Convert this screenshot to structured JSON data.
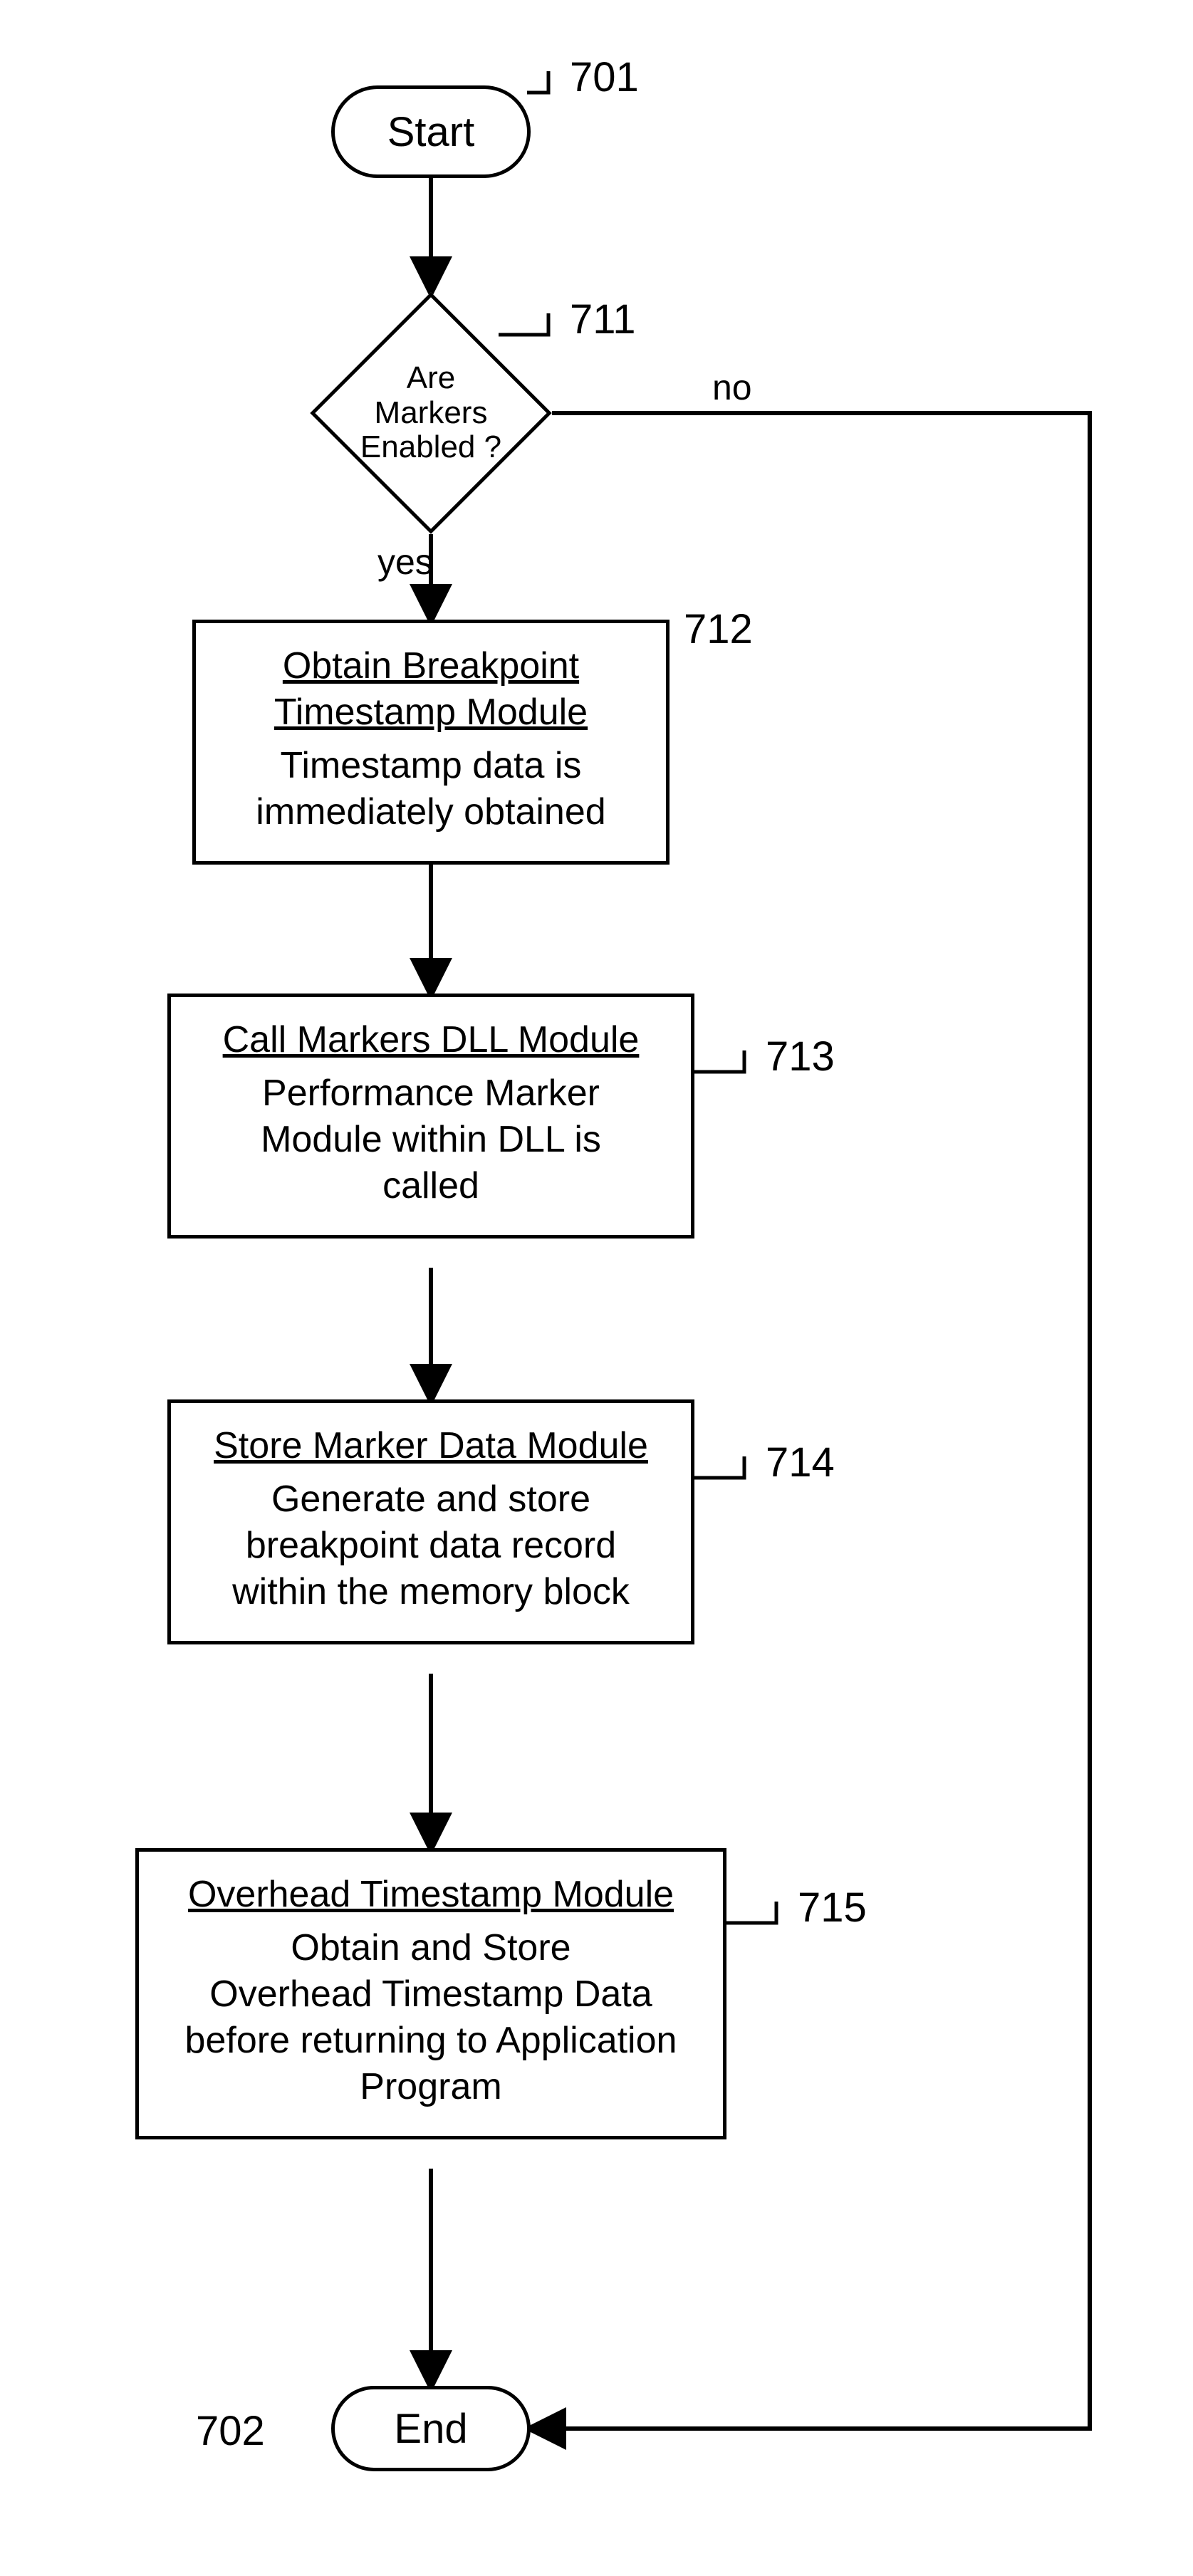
{
  "chart_data": {
    "type": "flowchart",
    "nodes": [
      {
        "id": "start",
        "kind": "terminator",
        "text": "Start",
        "ref": "701"
      },
      {
        "id": "decide",
        "kind": "decision",
        "lines": [
          "Are",
          "Markers",
          "Enabled ?"
        ],
        "ref": "711",
        "yes_to": "step712",
        "no_to": "end"
      },
      {
        "id": "step712",
        "kind": "process",
        "title": "Obtain Breakpoint Timestamp Module",
        "body": "Timestamp data is immediately obtained",
        "ref": "712"
      },
      {
        "id": "step713",
        "kind": "process",
        "title": "Call Markers DLL Module",
        "body": "Performance Marker Module within DLL is called",
        "ref": "713"
      },
      {
        "id": "step714",
        "kind": "process",
        "title": "Store Marker Data Module",
        "body": "Generate and store breakpoint data record within the memory block",
        "ref": "714"
      },
      {
        "id": "step715",
        "kind": "process",
        "title": "Overhead Timestamp Module",
        "body": "Obtain and Store Overhead Timestamp  Data before returning to Application Program",
        "ref": "715"
      },
      {
        "id": "end",
        "kind": "terminator",
        "text": "End",
        "ref": "702"
      }
    ],
    "edge_labels": {
      "yes": "yes",
      "no": "no"
    }
  },
  "refs": {
    "start": "701",
    "decide": "711",
    "step712": "712",
    "step713": "713",
    "step714": "714",
    "step715": "715",
    "end": "702"
  },
  "text": {
    "start": "Start",
    "end": "End",
    "decide_l1": "Are",
    "decide_l2": "Markers",
    "decide_l3": "Enabled ?",
    "yes": "yes",
    "no": "no",
    "s712_title_l1": "Obtain Breakpoint",
    "s712_title_l2": "Timestamp Module",
    "s712_body_l1": "Timestamp data is",
    "s712_body_l2": "immediately obtained",
    "s713_title_l1": "Call Markers DLL Module",
    "s713_body_l1": "Performance Marker",
    "s713_body_l2": "Module within DLL is",
    "s713_body_l3": "called",
    "s714_title_l1": "Store Marker Data Module",
    "s714_body_l1": "Generate and store",
    "s714_body_l2": "breakpoint data record",
    "s714_body_l3": "within the memory block",
    "s715_title_l1": "Overhead Timestamp Module",
    "s715_body_l1": "Obtain and Store",
    "s715_body_l2": "Overhead Timestamp  Data",
    "s715_body_l3": "before returning to Application",
    "s715_body_l4": "Program"
  }
}
